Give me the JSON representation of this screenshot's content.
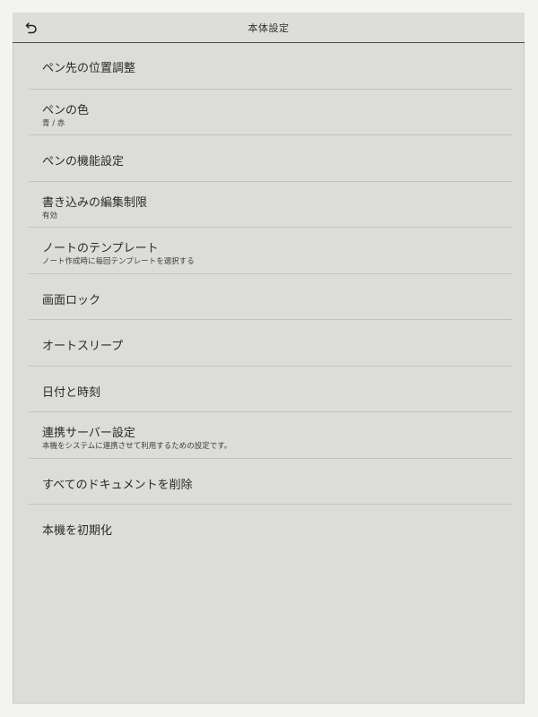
{
  "header": {
    "title": "本体設定",
    "back_icon": "back-arrow-icon"
  },
  "items": [
    {
      "label": "ペン先の位置調整",
      "sub": ""
    },
    {
      "label": "ペンの色",
      "sub": "青 / 赤"
    },
    {
      "label": "ペンの機能設定",
      "sub": ""
    },
    {
      "label": "書き込みの編集制限",
      "sub": "有効"
    },
    {
      "label": "ノートのテンプレート",
      "sub": "ノート作成時に毎回テンプレートを選択する"
    },
    {
      "label": "画面ロック",
      "sub": ""
    },
    {
      "label": "オートスリープ",
      "sub": ""
    },
    {
      "label": "日付と時刻",
      "sub": ""
    },
    {
      "label": "連携サーバー設定",
      "sub": "本機をシステムに連携させて利用するための設定です。"
    },
    {
      "label": "すべてのドキュメントを削除",
      "sub": ""
    },
    {
      "label": "本機を初期化",
      "sub": ""
    }
  ]
}
